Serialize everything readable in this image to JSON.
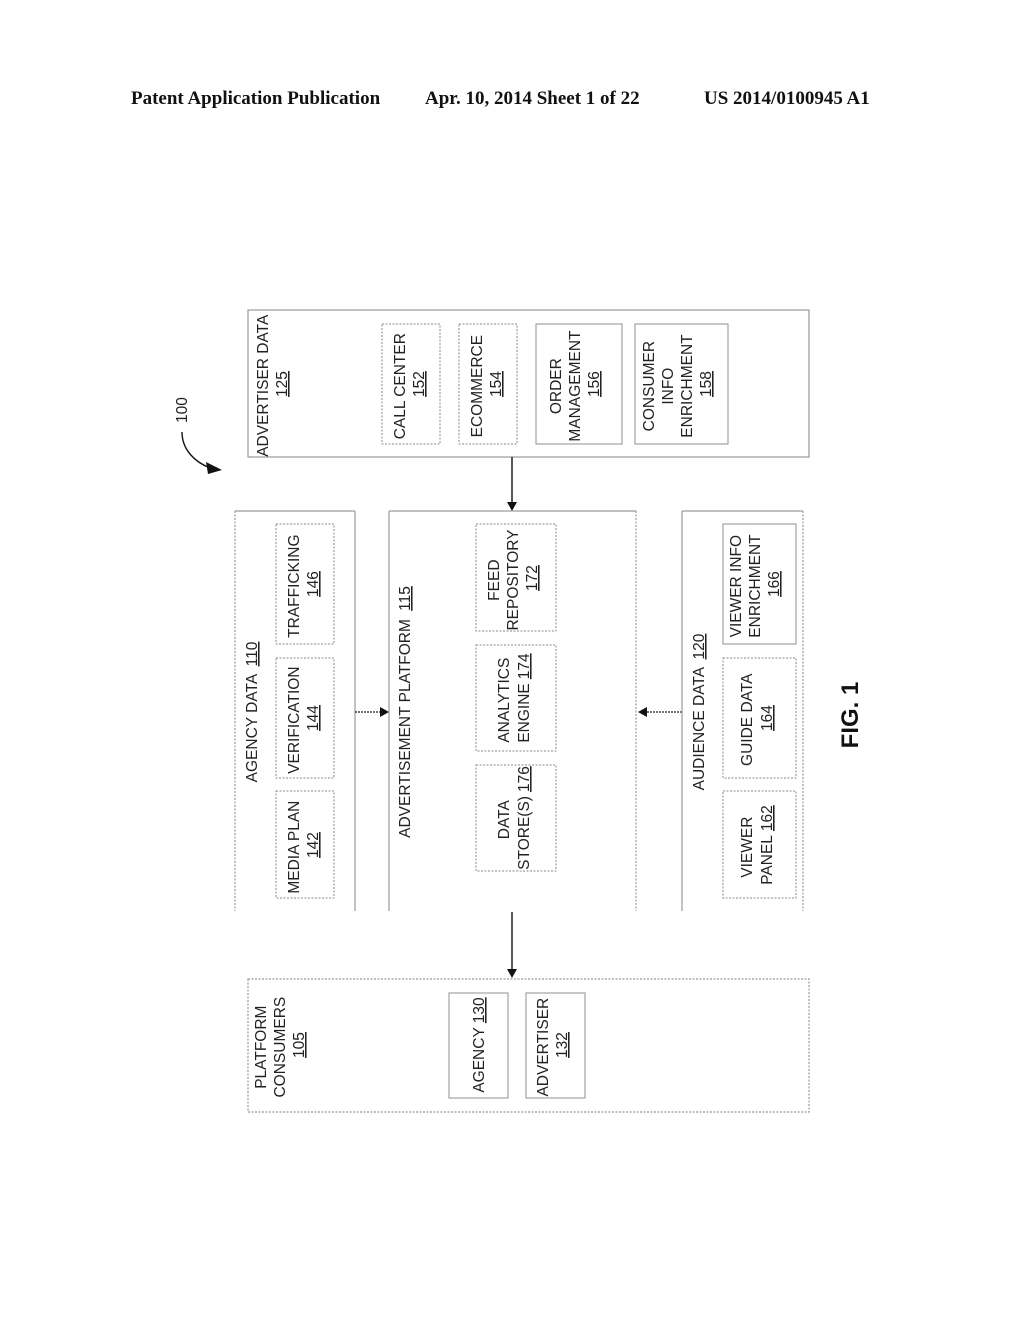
{
  "header": {
    "left": "Patent Application Publication",
    "middle": "Apr. 10, 2014  Sheet 1 of 22",
    "right": "US 2014/0100945 A1"
  },
  "figure": {
    "label": "FIG. 1",
    "ref_number": "100"
  },
  "advertiser_data": {
    "title": "ADVERTISER DATA",
    "ref": "125",
    "items": [
      {
        "lines": [
          "CALL CENTER"
        ],
        "ref": "152"
      },
      {
        "lines": [
          "ECOMMERCE"
        ],
        "ref": "154"
      },
      {
        "lines": [
          "ORDER",
          "MANAGEMENT"
        ],
        "ref": "156"
      },
      {
        "lines": [
          "CONSUMER",
          "INFO",
          "ENRICHMENT"
        ],
        "ref": "158"
      }
    ]
  },
  "agency_data": {
    "title": "AGENCY DATA",
    "ref": "110",
    "items": [
      {
        "lines": [
          "MEDIA PLAN"
        ],
        "ref": "142"
      },
      {
        "lines": [
          "VERIFICATION"
        ],
        "ref": "144"
      },
      {
        "lines": [
          "TRAFFICKING"
        ],
        "ref": "146"
      }
    ]
  },
  "advertisement_platform": {
    "title": "ADVERTISEMENT PLATFORM",
    "ref": "115",
    "items": [
      {
        "line1": "DATA",
        "line2": "STORE(S)",
        "ref": "176"
      },
      {
        "line1": "ANALYTICS",
        "line2": "ENGINE",
        "ref": "174"
      },
      {
        "line1": "FEED",
        "line2": "REPOSITORY",
        "ref": "172"
      }
    ]
  },
  "audience_data": {
    "title": "AUDIENCE DATA",
    "ref": "120",
    "items": [
      {
        "line1": "VIEWER",
        "line2": "PANEL",
        "ref": "162"
      },
      {
        "line1": "GUIDE DATA",
        "line2": "",
        "ref": "164"
      },
      {
        "line1": "VIEWER INFO",
        "line2": "ENRICHMENT",
        "ref": "166"
      }
    ]
  },
  "platform_consumers": {
    "title_lines": [
      "PLATFORM",
      "CONSUMERS"
    ],
    "ref": "105",
    "items": [
      {
        "label": "AGENCY",
        "ref": "130"
      },
      {
        "label": "ADVERTISER",
        "ref": "132"
      }
    ]
  }
}
